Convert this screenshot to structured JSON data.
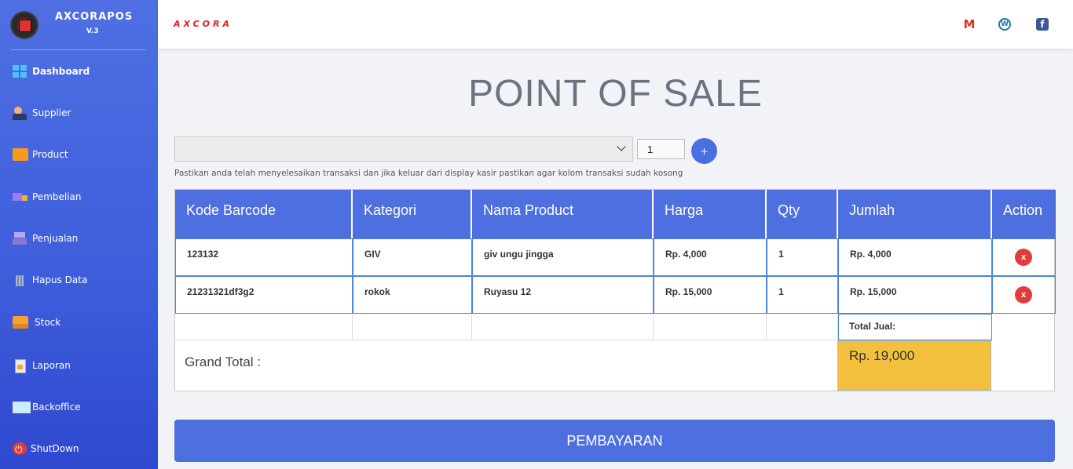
{
  "brand": {
    "name": "AXCORAPOS",
    "version": "V.3"
  },
  "topbar": {
    "logo_text": "AXCORA",
    "icons": [
      "gmail-icon",
      "wordpress-icon",
      "facebook-icon"
    ]
  },
  "sidebar": {
    "items": [
      {
        "label": "Dashboard",
        "icon": "windows-icon"
      },
      {
        "label": "Supplier",
        "icon": "supplier-icon"
      },
      {
        "label": "Product",
        "icon": "product-icon"
      },
      {
        "label": "Pembelian",
        "icon": "truck-icon"
      },
      {
        "label": "Penjualan",
        "icon": "cash-register-icon"
      },
      {
        "label": "Hapus Data",
        "icon": "trash-icon"
      },
      {
        "label": "Stock",
        "icon": "box-icon"
      },
      {
        "label": "Laporan",
        "icon": "report-icon"
      },
      {
        "label": "Backoffice",
        "icon": "monitor-icon"
      },
      {
        "label": "ShutDown",
        "icon": "power-icon"
      }
    ]
  },
  "page": {
    "title": "POINT OF SALE",
    "product_select_value": "",
    "qty_value": "1",
    "add_label": "+",
    "hint": "Pastikan anda telah menyelesaikan transaksi dan jika keluar dari display kasir pastikan agar kolom transaksi sudah kosong"
  },
  "table": {
    "headers": [
      "Kode Barcode",
      "Kategori",
      "Nama Product",
      "Harga",
      "Qty",
      "Jumlah",
      "Action"
    ],
    "rows": [
      [
        "123132",
        "GIV",
        "giv ungu jingga",
        "Rp. 4,000",
        "1",
        "Rp. 4,000",
        "x"
      ],
      [
        "21231321df3g2",
        "rokok",
        "Ruyasu 12",
        "Rp. 15,000",
        "1",
        "Rp. 15,000",
        "x"
      ]
    ],
    "total_jual_label": "Total Jual:",
    "grand_total_label": "Grand Total :",
    "grand_total_value": "Rp. 19,000"
  },
  "pay_button": "PEMBAYARAN",
  "colors": {
    "primary": "#4d6fe0",
    "sidebar": "#3f5fdc",
    "delete": "#e33b3b",
    "total": "#f3c03e",
    "logo": "#e11d2a"
  }
}
